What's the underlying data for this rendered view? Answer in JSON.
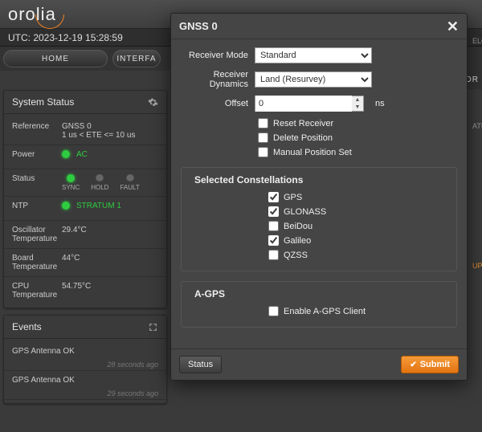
{
  "logo_text": "orolia",
  "utc_label": "UTC: 2023-12-19 15:28:59",
  "nav": {
    "home": "HOME",
    "interfaces_cut": "INTERFA",
    "right_cut": "TOR"
  },
  "right_frags": {
    "elc": "ELC",
    "atur": "ATUR",
    "up": "UP"
  },
  "status_panel": {
    "title": "System Status",
    "reference_label": "Reference",
    "reference_val1": "GNSS 0",
    "reference_val2": "1 us < ETE <= 10 us",
    "power_label": "Power",
    "power_val": "AC",
    "status_label": "Status",
    "leds": [
      "SYNC",
      "HOLD",
      "FAULT"
    ],
    "ntp_label": "NTP",
    "ntp_val": "STRATUM 1",
    "osc_label": "Oscillator Temperature",
    "osc_val": "29.4°C",
    "board_label": "Board Temperature",
    "board_val": "44°C",
    "cpu_label": "CPU Temperature",
    "cpu_val": "54.75°C"
  },
  "events_panel": {
    "title": "Events",
    "items": [
      {
        "title": "GPS Antenna OK",
        "time": "28 seconds ago"
      },
      {
        "title": "GPS Antenna OK",
        "time": "29 seconds ago"
      }
    ]
  },
  "modal": {
    "title": "GNSS 0",
    "receiver_mode_label": "Receiver Mode",
    "receiver_mode_val": "Standard",
    "receiver_dyn_label": "Receiver Dynamics",
    "receiver_dyn_val": "Land (Resurvey)",
    "offset_label": "Offset",
    "offset_val": "0",
    "offset_unit": "ns",
    "reset_receiver_label": "Reset Receiver",
    "delete_position_label": "Delete Position",
    "manual_position_label": "Manual Position Set",
    "constellations_title": "Selected Constellations",
    "gps_label": "GPS",
    "glonass_label": "GLONASS",
    "beidou_label": "BeiDou",
    "galileo_label": "Galileo",
    "qzss_label": "QZSS",
    "agps_title": "A-GPS",
    "agps_enable_label": "Enable A-GPS Client",
    "status_btn": "Status",
    "submit_btn": "Submit"
  }
}
